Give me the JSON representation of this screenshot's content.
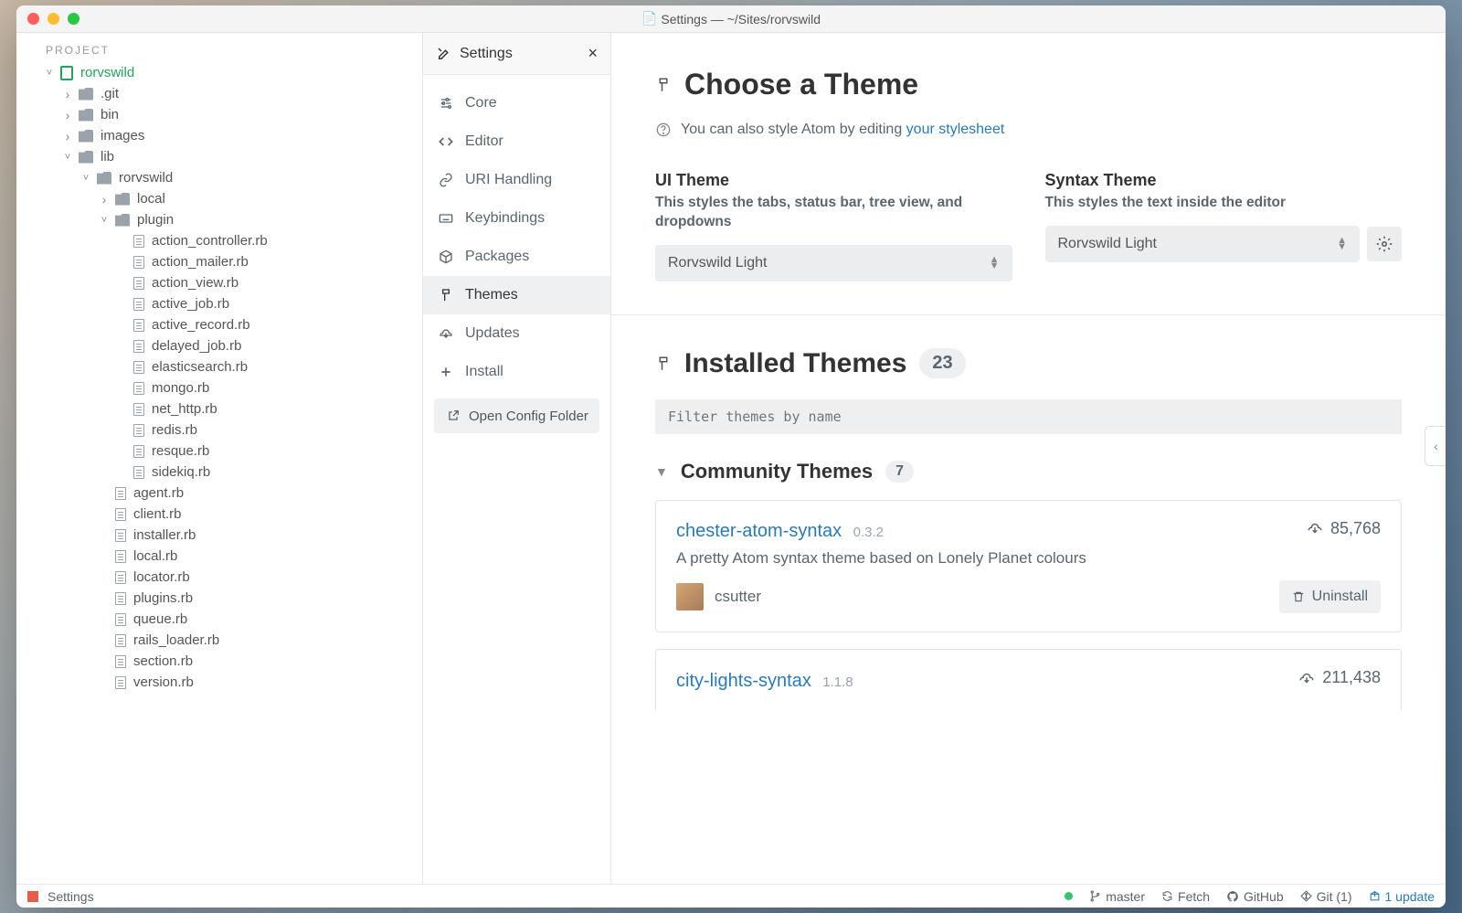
{
  "window": {
    "title": "Settings — ~/Sites/rorvswild"
  },
  "project": {
    "label": "PROJECT",
    "root": "rorvswild",
    "tree": [
      {
        "name": ".git",
        "type": "folder",
        "depth": 1,
        "expanded": false
      },
      {
        "name": "bin",
        "type": "folder",
        "depth": 1,
        "expanded": false
      },
      {
        "name": "images",
        "type": "folder",
        "depth": 1,
        "expanded": false
      },
      {
        "name": "lib",
        "type": "folder",
        "depth": 1,
        "expanded": true
      },
      {
        "name": "rorvswild",
        "type": "folder",
        "depth": 2,
        "expanded": true
      },
      {
        "name": "local",
        "type": "folder",
        "depth": 3,
        "expanded": false
      },
      {
        "name": "plugin",
        "type": "folder",
        "depth": 3,
        "expanded": true
      },
      {
        "name": "action_controller.rb",
        "type": "file",
        "depth": 4
      },
      {
        "name": "action_mailer.rb",
        "type": "file",
        "depth": 4
      },
      {
        "name": "action_view.rb",
        "type": "file",
        "depth": 4
      },
      {
        "name": "active_job.rb",
        "type": "file",
        "depth": 4
      },
      {
        "name": "active_record.rb",
        "type": "file",
        "depth": 4
      },
      {
        "name": "delayed_job.rb",
        "type": "file",
        "depth": 4
      },
      {
        "name": "elasticsearch.rb",
        "type": "file",
        "depth": 4
      },
      {
        "name": "mongo.rb",
        "type": "file",
        "depth": 4
      },
      {
        "name": "net_http.rb",
        "type": "file",
        "depth": 4
      },
      {
        "name": "redis.rb",
        "type": "file",
        "depth": 4
      },
      {
        "name": "resque.rb",
        "type": "file",
        "depth": 4
      },
      {
        "name": "sidekiq.rb",
        "type": "file",
        "depth": 4
      },
      {
        "name": "agent.rb",
        "type": "file",
        "depth": 3
      },
      {
        "name": "client.rb",
        "type": "file",
        "depth": 3
      },
      {
        "name": "installer.rb",
        "type": "file",
        "depth": 3
      },
      {
        "name": "local.rb",
        "type": "file",
        "depth": 3
      },
      {
        "name": "locator.rb",
        "type": "file",
        "depth": 3
      },
      {
        "name": "plugins.rb",
        "type": "file",
        "depth": 3
      },
      {
        "name": "queue.rb",
        "type": "file",
        "depth": 3
      },
      {
        "name": "rails_loader.rb",
        "type": "file",
        "depth": 3
      },
      {
        "name": "section.rb",
        "type": "file",
        "depth": 3
      },
      {
        "name": "version.rb",
        "type": "file",
        "depth": 3
      }
    ]
  },
  "settings_tab": {
    "title": "Settings"
  },
  "settings_nav": {
    "items": [
      {
        "icon": "sliders",
        "label": "Core"
      },
      {
        "icon": "code",
        "label": "Editor"
      },
      {
        "icon": "link",
        "label": "URI Handling"
      },
      {
        "icon": "keyboard",
        "label": "Keybindings"
      },
      {
        "icon": "package",
        "label": "Packages"
      },
      {
        "icon": "paint",
        "label": "Themes"
      },
      {
        "icon": "cloud",
        "label": "Updates"
      },
      {
        "icon": "plus",
        "label": "Install"
      }
    ],
    "config_button": "Open Config Folder"
  },
  "themes": {
    "heading": "Choose a Theme",
    "tip_prefix": "You can also style Atom by editing ",
    "tip_link": "your stylesheet",
    "ui": {
      "label": "UI Theme",
      "desc": "This styles the tabs, status bar, tree view, and dropdowns",
      "value": "Rorvswild Light"
    },
    "syntax": {
      "label": "Syntax Theme",
      "desc": "This styles the text inside the editor",
      "value": "Rorvswild Light"
    },
    "installed_heading": "Installed Themes",
    "installed_count": "23",
    "filter_placeholder": "Filter themes by name",
    "community_heading": "Community Themes",
    "community_count": "7",
    "packages": [
      {
        "name": "chester-atom-syntax",
        "version": "0.3.2",
        "downloads": "85,768",
        "desc": "A pretty Atom syntax theme based on Lonely Planet colours",
        "author": "csutter",
        "uninstall": "Uninstall"
      },
      {
        "name": "city-lights-syntax",
        "version": "1.1.8",
        "downloads": "211,438"
      }
    ]
  },
  "statusbar": {
    "settings": "Settings",
    "branch": "master",
    "fetch": "Fetch",
    "github": "GitHub",
    "git": "Git (1)",
    "updates": "1 update"
  }
}
